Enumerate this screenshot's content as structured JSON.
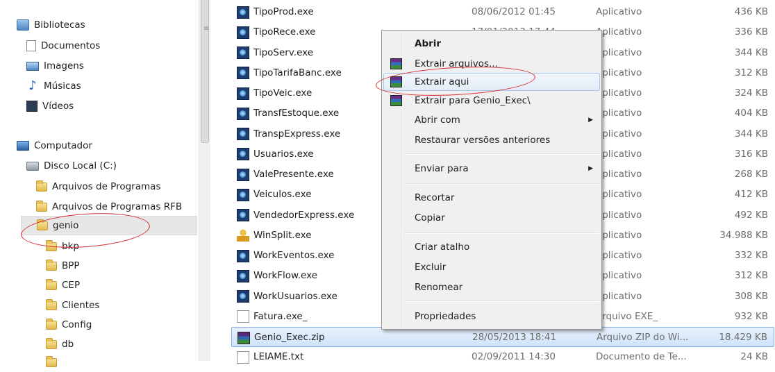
{
  "nav": {
    "items": [
      {
        "label": "Bibliotecas",
        "icon": "library-icon"
      },
      {
        "label": "Documentos",
        "icon": "documents-icon"
      },
      {
        "label": "Imagens",
        "icon": "pictures-icon"
      },
      {
        "label": "Músicas",
        "icon": "music-icon"
      },
      {
        "label": "Vídeos",
        "icon": "videos-icon"
      },
      {
        "label": "Computador",
        "icon": "computer-icon"
      },
      {
        "label": "Disco Local (C:)",
        "icon": "drive-icon"
      },
      {
        "label": "Arquivos de Programas",
        "icon": "folder-icon"
      },
      {
        "label": "Arquivos de Programas RFB",
        "icon": "folder-icon"
      },
      {
        "label": "genio",
        "icon": "folder-icon",
        "selected": true
      },
      {
        "label": "bkp",
        "icon": "folder-icon"
      },
      {
        "label": "BPP",
        "icon": "folder-icon"
      },
      {
        "label": "CEP",
        "icon": "folder-icon"
      },
      {
        "label": "Clientes",
        "icon": "folder-icon"
      },
      {
        "label": "Config",
        "icon": "folder-icon"
      },
      {
        "label": "db",
        "icon": "folder-icon"
      }
    ]
  },
  "files": [
    {
      "name": "TipoProd.exe",
      "date": "08/06/2012 01:45",
      "type": "Aplicativo",
      "size": "436 KB",
      "icon": "exe"
    },
    {
      "name": "TipoRece.exe",
      "date": "17/01/2013 17:44",
      "type": "Aplicativo",
      "size": "336 KB",
      "icon": "exe"
    },
    {
      "name": "TipoServ.exe",
      "date": "",
      "type": "Aplicativo",
      "size": "344 KB",
      "icon": "exe"
    },
    {
      "name": "TipoTarifaBanc.exe",
      "date": "",
      "type": "Aplicativo",
      "size": "312 KB",
      "icon": "exe"
    },
    {
      "name": "TipoVeic.exe",
      "date": "",
      "type": "Aplicativo",
      "size": "324 KB",
      "icon": "exe"
    },
    {
      "name": "TransfEstoque.exe",
      "date": "",
      "type": "Aplicativo",
      "size": "404 KB",
      "icon": "exe"
    },
    {
      "name": "TranspExpress.exe",
      "date": "",
      "type": "Aplicativo",
      "size": "344 KB",
      "icon": "exe"
    },
    {
      "name": "Usuarios.exe",
      "date": "",
      "type": "Aplicativo",
      "size": "316 KB",
      "icon": "exe"
    },
    {
      "name": "ValePresente.exe",
      "date": "",
      "type": "Aplicativo",
      "size": "268 KB",
      "icon": "exe"
    },
    {
      "name": "Veiculos.exe",
      "date": "",
      "type": "Aplicativo",
      "size": "412 KB",
      "icon": "exe"
    },
    {
      "name": "VendedorExpress.exe",
      "date": "",
      "type": "Aplicativo",
      "size": "492 KB",
      "icon": "exe"
    },
    {
      "name": "WinSplit.exe",
      "date": "",
      "type": "Aplicativo",
      "size": "34.988 KB",
      "icon": "user"
    },
    {
      "name": "WorkEventos.exe",
      "date": "",
      "type": "Aplicativo",
      "size": "332 KB",
      "icon": "exe"
    },
    {
      "name": "WorkFlow.exe",
      "date": "",
      "type": "Aplicativo",
      "size": "312 KB",
      "icon": "exe"
    },
    {
      "name": "WorkUsuarios.exe",
      "date": "",
      "type": "Aplicativo",
      "size": "308 KB",
      "icon": "exe"
    },
    {
      "name": "Fatura.exe_",
      "date": "",
      "type": "Arquivo EXE_",
      "size": "932 KB",
      "icon": "txt"
    },
    {
      "name": "Genio_Exec.zip",
      "date": "28/05/2013 18:41",
      "type": "Arquivo ZIP do Wi...",
      "size": "18.429 KB",
      "icon": "zip",
      "selected": true
    },
    {
      "name": "LEIAME.txt",
      "date": "02/09/2011 14:30",
      "type": "Documento de Te...",
      "size": "24 KB",
      "icon": "txt"
    }
  ],
  "context_menu": {
    "open": "Abrir",
    "extract_files": "Extrair arquivos...",
    "extract_here": "Extrair aqui",
    "extract_to": "Extrair para Genio_Exec\\",
    "open_with": "Abrir com",
    "restore": "Restaurar versões anteriores",
    "send_to": "Enviar para",
    "cut": "Recortar",
    "copy": "Copiar",
    "create_shortcut": "Criar atalho",
    "delete": "Excluir",
    "rename": "Renomear",
    "properties": "Propriedades",
    "submenu_arrow": "▶"
  },
  "colors": {
    "selection": "#cfe3fa",
    "annotation": "#d6252a",
    "menu_bg": "#f0f0f0"
  }
}
